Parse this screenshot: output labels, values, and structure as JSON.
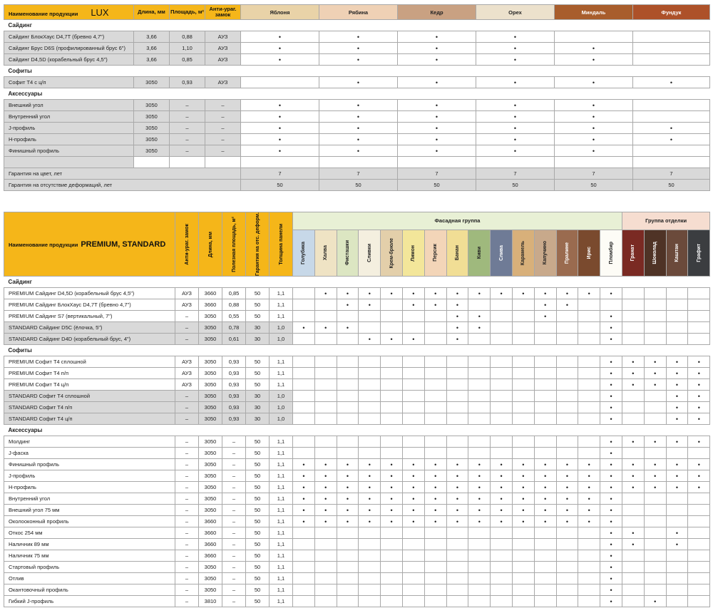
{
  "lux": {
    "name_header": "Наименование продукции",
    "brand": "LUX",
    "h_length": "Длина, мм",
    "h_area": "Площадь, м²",
    "h_lock": "Анти-ураг. замок",
    "colors": [
      {
        "name": "Яблоня",
        "bg": "#e9d3a8",
        "fg": "#222"
      },
      {
        "name": "Рябина",
        "bg": "#efd1b5",
        "fg": "#222"
      },
      {
        "name": "Кедр",
        "bg": "#c9a182",
        "fg": "#222"
      },
      {
        "name": "Орех",
        "bg": "#ece1cc",
        "fg": "#222"
      },
      {
        "name": "Миндаль",
        "bg": "#a85d2c",
        "fg": "#fff"
      },
      {
        "name": "Фундук",
        "bg": "#ad5129",
        "fg": "#fff"
      }
    ],
    "sections": [
      {
        "title": "Сайдинг",
        "rows": [
          {
            "name": "Сайдинг БлокХаус D4,7T (бревно 4,7\")",
            "len": "3,66",
            "area": "0,88",
            "lock": "АУЗ",
            "dots": [
              1,
              1,
              1,
              1,
              0,
              0
            ]
          },
          {
            "name": "Сайдинг Брус D6S (профилированный брус 6\")",
            "len": "3,66",
            "area": "1,10",
            "lock": "АУЗ",
            "dots": [
              1,
              1,
              1,
              1,
              1,
              0
            ]
          },
          {
            "name": "Сайдинг D4,5D (корабельный брус 4,5\")",
            "len": "3,66",
            "area": "0,85",
            "lock": "АУЗ",
            "dots": [
              1,
              1,
              1,
              1,
              1,
              0
            ]
          }
        ]
      },
      {
        "title": "Софиты",
        "rows": [
          {
            "name": "Софит Т4 с ц/п",
            "len": "3050",
            "area": "0,93",
            "lock": "АУЗ",
            "dots": [
              0,
              1,
              1,
              1,
              1,
              1
            ]
          }
        ]
      },
      {
        "title": "Аксессуары",
        "rows": [
          {
            "name": "Внешний угол",
            "len": "3050",
            "area": "–",
            "lock": "–",
            "dots": [
              1,
              1,
              1,
              1,
              1,
              0
            ]
          },
          {
            "name": "Внутренний угол",
            "len": "3050",
            "area": "–",
            "lock": "–",
            "dots": [
              1,
              1,
              1,
              1,
              1,
              0
            ]
          },
          {
            "name": "J-профиль",
            "len": "3050",
            "area": "–",
            "lock": "–",
            "dots": [
              1,
              1,
              1,
              1,
              1,
              1
            ]
          },
          {
            "name": "H-профиль",
            "len": "3050",
            "area": "–",
            "lock": "–",
            "dots": [
              1,
              1,
              1,
              1,
              1,
              1
            ]
          },
          {
            "name": "Финишный профиль",
            "len": "3050",
            "area": "–",
            "lock": "–",
            "dots": [
              1,
              1,
              1,
              1,
              1,
              0
            ]
          }
        ]
      }
    ],
    "warranty_color_label": "Гарантия на цвет, лет",
    "warranty_color": [
      "7",
      "7",
      "7",
      "7",
      "7",
      "7"
    ],
    "warranty_deform_label": "Гарантия на отсутствие деформаций, лет",
    "warranty_deform": [
      "50",
      "50",
      "50",
      "50",
      "50",
      "50"
    ]
  },
  "prem": {
    "name_header": "Наименование продукции",
    "brand": "PREMIUM, STANDARD",
    "h_lock": "Анти-ураг. замок",
    "h_len": "Длина, мм",
    "h_area": "Полезная площадь, м²",
    "h_warranty": "Гарантия на отс. деформ.",
    "h_thick": "Толщина панели",
    "group_facade": "Фасадная группа",
    "group_finish": "Группа отделки",
    "colors": [
      {
        "name": "Голубика",
        "bg": "#c7d8e8",
        "fg": "#222"
      },
      {
        "name": "Халва",
        "bg": "#efe3c4",
        "fg": "#222"
      },
      {
        "name": "Фисташки",
        "bg": "#dce6c2",
        "fg": "#222"
      },
      {
        "name": "Сливки",
        "bg": "#f4efdf",
        "fg": "#222"
      },
      {
        "name": "Крем-брюле",
        "bg": "#e3cfaa",
        "fg": "#222"
      },
      {
        "name": "Лимон",
        "bg": "#f3e69a",
        "fg": "#222"
      },
      {
        "name": "Персик",
        "bg": "#f3d5b8",
        "fg": "#222"
      },
      {
        "name": "Банан",
        "bg": "#f1de95",
        "fg": "#222"
      },
      {
        "name": "Киви",
        "bg": "#9fb97d",
        "fg": "#222"
      },
      {
        "name": "Слива",
        "bg": "#6f7b96",
        "fg": "#fff"
      },
      {
        "name": "Карамель",
        "bg": "#d8b07a",
        "fg": "#222"
      },
      {
        "name": "Капучино",
        "bg": "#c8a98b",
        "fg": "#222"
      },
      {
        "name": "Пралине",
        "bg": "#9a6b4f",
        "fg": "#fff"
      },
      {
        "name": "Ирис",
        "bg": "#7a4a2e",
        "fg": "#fff"
      },
      {
        "name": "Пломбир",
        "bg": "#fdfcf6",
        "fg": "#222"
      },
      {
        "name": "Гранат",
        "bg": "#7a2a23",
        "fg": "#fff"
      },
      {
        "name": "Шоколад",
        "bg": "#4f3326",
        "fg": "#fff"
      },
      {
        "name": "Каштан",
        "bg": "#6b4a3b",
        "fg": "#fff"
      },
      {
        "name": "Графит",
        "bg": "#3b3d40",
        "fg": "#fff"
      }
    ],
    "sections": [
      {
        "title": "Сайдинг",
        "rows": [
          {
            "name": "PREMIUM Сайдинг D4,5D (корабельный брус 4,5\")",
            "lock": "АУЗ",
            "len": "3660",
            "area": "0,85",
            "war": "50",
            "th": "1,1",
            "shade": "w",
            "dots": "0111111111111110000"
          },
          {
            "name": "PREMIUM Сайдинг БлокХаус D4,7T (бревно 4,7\")",
            "lock": "АУЗ",
            "len": "3660",
            "area": "0,88",
            "war": "50",
            "th": "1,1",
            "shade": "w",
            "dots": "0011011100011000000"
          },
          {
            "name": "PREMIUM Сайдинг S7 (вертикальный, 7\")",
            "lock": "–",
            "len": "3050",
            "area": "0,55",
            "war": "50",
            "th": "1,1",
            "shade": "w",
            "dots": "0000000110010010000"
          },
          {
            "name": "STANDARD Сайдинг D5C (ёлочка, 5\")",
            "lock": "–",
            "len": "3050",
            "area": "0,78",
            "war": "30",
            "th": "1,0",
            "shade": "g",
            "dots": "1110000110000010000"
          },
          {
            "name": "STANDARD Сайдинг D4D (корабельный брус, 4\")",
            "lock": "–",
            "len": "3050",
            "area": "0,61",
            "war": "30",
            "th": "1,0",
            "shade": "g",
            "dots": "0001110100000010000"
          }
        ]
      },
      {
        "title": "Софиты",
        "rows": [
          {
            "name": "PREMIUM Софит Т4 сплошной",
            "lock": "АУЗ",
            "len": "3050",
            "area": "0,93",
            "war": "50",
            "th": "1,1",
            "shade": "w",
            "dots": "0000000000000011111"
          },
          {
            "name": "PREMIUM Софит Т4 п/п",
            "lock": "АУЗ",
            "len": "3050",
            "area": "0,93",
            "war": "50",
            "th": "1,1",
            "shade": "w",
            "dots": "0000000000000011111"
          },
          {
            "name": "PREMIUM Софит Т4 ц/п",
            "lock": "АУЗ",
            "len": "3050",
            "area": "0,93",
            "war": "50",
            "th": "1,1",
            "shade": "w",
            "dots": "0000000000000011111"
          },
          {
            "name": "STANDARD Софит Т4 сплошной",
            "lock": "–",
            "len": "3050",
            "area": "0,93",
            "war": "30",
            "th": "1,0",
            "shade": "g",
            "dots": "0000000000000010011"
          },
          {
            "name": "STANDARD Софит Т4 п/п",
            "lock": "–",
            "len": "3050",
            "area": "0,93",
            "war": "30",
            "th": "1,0",
            "shade": "g",
            "dots": "0000000000000010011"
          },
          {
            "name": "STANDARD Софит Т4 ц/п",
            "lock": "–",
            "len": "3050",
            "area": "0,93",
            "war": "30",
            "th": "1,0",
            "shade": "g",
            "dots": "0000000000000010011"
          }
        ]
      },
      {
        "title": "Аксессуары",
        "rows": [
          {
            "name": "Молдинг",
            "lock": "–",
            "len": "3050",
            "area": "–",
            "war": "50",
            "th": "1,1",
            "shade": "w",
            "dots": "0000000000000011111"
          },
          {
            "name": "J-фаска",
            "lock": "–",
            "len": "3050",
            "area": "–",
            "war": "50",
            "th": "1,1",
            "shade": "w",
            "dots": "0000000000000010000"
          },
          {
            "name": "Финишный профиль",
            "lock": "–",
            "len": "3050",
            "area": "–",
            "war": "50",
            "th": "1,1",
            "shade": "w",
            "dots": "1111111111111111111"
          },
          {
            "name": "J-профиль",
            "lock": "–",
            "len": "3050",
            "area": "–",
            "war": "50",
            "th": "1,1",
            "shade": "w",
            "dots": "1111111111111111111"
          },
          {
            "name": "H-профиль",
            "lock": "–",
            "len": "3050",
            "area": "–",
            "war": "50",
            "th": "1,1",
            "shade": "w",
            "dots": "1111111111111111111"
          },
          {
            "name": "Внутренний угол",
            "lock": "–",
            "len": "3050",
            "area": "–",
            "war": "50",
            "th": "1,1",
            "shade": "w",
            "dots": "1111111111111110000"
          },
          {
            "name": "Внешний угол 75 мм",
            "lock": "–",
            "len": "3050",
            "area": "–",
            "war": "50",
            "th": "1,1",
            "shade": "w",
            "dots": "1111111111111110000"
          },
          {
            "name": "Околооконный профиль",
            "lock": "–",
            "len": "3660",
            "area": "–",
            "war": "50",
            "th": "1,1",
            "shade": "w",
            "dots": "1111111111111110000"
          },
          {
            "name": "Откос 254 мм",
            "lock": "–",
            "len": "3660",
            "area": "–",
            "war": "50",
            "th": "1,1",
            "shade": "w",
            "dots": "0000000000000011010"
          },
          {
            "name": "Наличник 89 мм",
            "lock": "–",
            "len": "3660",
            "area": "–",
            "war": "50",
            "th": "1,1",
            "shade": "w",
            "dots": "0000000000000011010"
          },
          {
            "name": "Наличник 75 мм",
            "lock": "–",
            "len": "3660",
            "area": "–",
            "war": "50",
            "th": "1,1",
            "shade": "w",
            "dots": "0000000000000010000"
          },
          {
            "name": "Стартовый профиль",
            "lock": "–",
            "len": "3050",
            "area": "–",
            "war": "50",
            "th": "1,1",
            "shade": "w",
            "dots": "0000000000000010000"
          },
          {
            "name": "Отлив",
            "lock": "–",
            "len": "3050",
            "area": "–",
            "war": "50",
            "th": "1,1",
            "shade": "w",
            "dots": "0000000000000010000"
          },
          {
            "name": "Окантовочный профиль",
            "lock": "–",
            "len": "3050",
            "area": "–",
            "war": "50",
            "th": "1,1",
            "shade": "w",
            "dots": "0000000000000010000"
          },
          {
            "name": "Гибкий J-профиль",
            "lock": "–",
            "len": "3810",
            "area": "–",
            "war": "50",
            "th": "1,1",
            "shade": "w",
            "dots": "0000000000000010100"
          }
        ]
      }
    ]
  },
  "colors": {
    "header_yellow": "#f5b619",
    "grey": "#d9d9d9",
    "facade_green": "#e8f0d5",
    "finish_pink": "#f6ddd0",
    "dot": "#111111"
  }
}
